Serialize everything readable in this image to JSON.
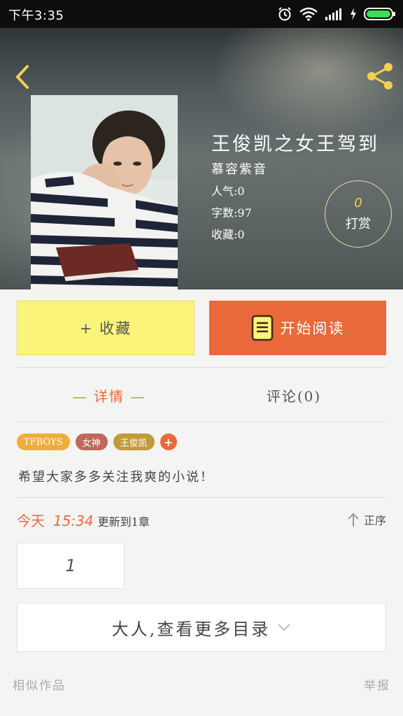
{
  "status_bar": {
    "time": "下午3:35",
    "icons": [
      "alarm-icon",
      "wifi-icon",
      "signal-icon",
      "charging-icon",
      "battery-icon"
    ]
  },
  "header": {
    "back_icon": "back-arrow-icon",
    "share_icon": "share-icon",
    "accent_color": "#f2cf53"
  },
  "book": {
    "title": "王俊凯之女王驾到",
    "author": "慕容紫音",
    "popularity": "人气:0",
    "word_count": "字数:97",
    "favorites": "收藏:0",
    "tip_count": "0",
    "tip_label": "打赏"
  },
  "actions": {
    "favorite_label": "+ 收藏",
    "read_label": "开始阅读",
    "favorite_color": "#fbf47a",
    "read_color": "#e9693a"
  },
  "tabs": [
    {
      "label": "— 详情 —",
      "active": true
    },
    {
      "label": "评论(0)",
      "active": false
    }
  ],
  "tags": [
    {
      "label": "TFBOYS",
      "color": "#f0ad3c"
    },
    {
      "label": "女神",
      "color": "#c0685a"
    },
    {
      "label": "王俊凯",
      "color": "#c29a3a"
    },
    {
      "label": "+",
      "color": "#e9693a"
    }
  ],
  "description": "希望大家多多关注我爽的小说！",
  "update": {
    "day": "今天",
    "time": "15:34",
    "text": "更新到1章",
    "sort_label": "正序"
  },
  "chapters": [
    "1"
  ],
  "more_catalog_label": "大人,查看更多目录",
  "footer": {
    "similar_label": "相似作品",
    "report_label": "举报"
  }
}
